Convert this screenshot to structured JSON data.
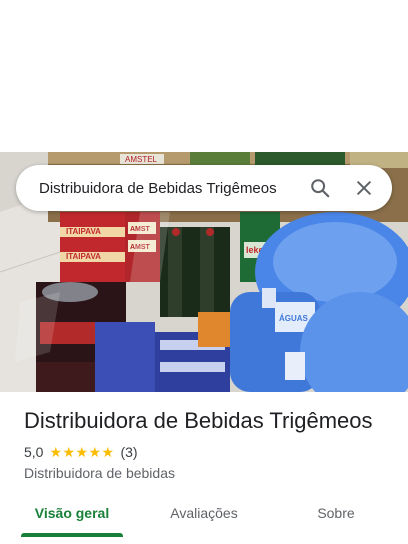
{
  "search": {
    "query": "Distribuidora de Bebidas Trigêmeos"
  },
  "place": {
    "name": "Distribuidora de Bebidas Trigêmeos",
    "rating": "5,0",
    "stars": 5,
    "review_count": "(3)",
    "category": "Distribuidora de bebidas"
  },
  "photo": {
    "shelf_labels": [
      "AMSTEL",
      "ITAIPAVA",
      "ITAIPAVA",
      "AMST",
      "AMST",
      "lekel",
      "ÁGUAS"
    ]
  },
  "tabs": [
    {
      "label": "Visão geral",
      "active": true
    },
    {
      "label": "Avaliações",
      "active": false
    },
    {
      "label": "Sobre",
      "active": false
    }
  ],
  "colors": {
    "accent_green": "#188038",
    "star_yellow": "#fbbc04",
    "text_primary": "#202124",
    "text_secondary": "#5f6368"
  },
  "icons": [
    "search-icon",
    "close-icon",
    "star-icon"
  ]
}
